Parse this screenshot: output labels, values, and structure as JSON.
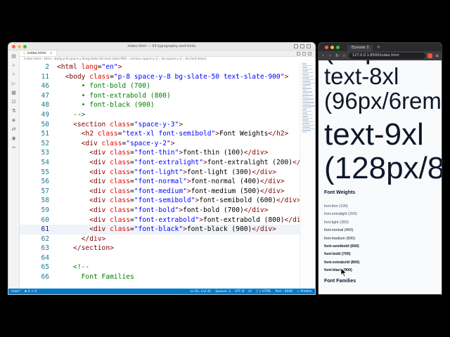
{
  "vscode": {
    "window_title": "index.html — 03-typography-and-fonts",
    "tab": {
      "name": "index.html",
      "close": "×"
    },
    "breadcrumb": "index.html › html › body.p-8.space-y-8.bg-slate-50.text-slate-900 › section.space-y-3 › div.space-y-2 › div.font-black",
    "activity_icons": [
      "files-icon",
      "search-icon",
      "source-control-icon",
      "run-debug-icon",
      "extensions-icon",
      "remote-icon",
      "testing-icon",
      "docker-icon",
      "live-share-icon",
      "github-icon",
      "tailwind-icon"
    ],
    "active_line": 61,
    "lines": [
      {
        "n": "2",
        "c": [
          [
            "t-tag",
            "<html "
          ],
          [
            "t-attr",
            "lang"
          ],
          [
            "t-txt",
            "="
          ],
          [
            "t-str",
            "\"en\""
          ],
          [
            "t-tag",
            ">"
          ]
        ]
      },
      {
        "n": "11",
        "c": [
          [
            "t-txt",
            "  "
          ],
          [
            "t-tag",
            "<body "
          ],
          [
            "t-attr",
            "class"
          ],
          [
            "t-txt",
            "="
          ],
          [
            "t-str",
            "\"p-8 space-y-8 bg-slate-50 text-slate-900\""
          ],
          [
            "t-tag",
            ">"
          ]
        ]
      },
      {
        "n": "46",
        "c": [
          [
            "t-com",
            "      • font-bold (700)"
          ]
        ]
      },
      {
        "n": "47",
        "c": [
          [
            "t-com",
            "      • font-extrabold (800)"
          ]
        ]
      },
      {
        "n": "48",
        "c": [
          [
            "t-com",
            "      • font-black (900)"
          ]
        ]
      },
      {
        "n": "49",
        "c": [
          [
            "t-com",
            "    -->"
          ]
        ]
      },
      {
        "n": "50",
        "c": [
          [
            "t-txt",
            "    "
          ],
          [
            "t-tag",
            "<section "
          ],
          [
            "t-attr",
            "class"
          ],
          [
            "t-txt",
            "="
          ],
          [
            "t-str",
            "\"space-y-3\""
          ],
          [
            "t-tag",
            ">"
          ]
        ]
      },
      {
        "n": "51",
        "c": [
          [
            "t-txt",
            "      "
          ],
          [
            "t-tag",
            "<h2 "
          ],
          [
            "t-attr",
            "class"
          ],
          [
            "t-txt",
            "="
          ],
          [
            "t-str",
            "\"text-xl font-semibold\""
          ],
          [
            "t-tag",
            ">"
          ],
          [
            "t-txt",
            "Font Weights"
          ],
          [
            "t-tag",
            "</h2>"
          ]
        ]
      },
      {
        "n": "52",
        "c": [
          [
            "t-txt",
            "      "
          ],
          [
            "t-tag",
            "<div "
          ],
          [
            "t-attr",
            "class"
          ],
          [
            "t-txt",
            "="
          ],
          [
            "t-str",
            "\"space-y-2\""
          ],
          [
            "t-tag",
            ">"
          ]
        ]
      },
      {
        "n": "53",
        "c": [
          [
            "t-txt",
            "        "
          ],
          [
            "t-tag",
            "<div "
          ],
          [
            "t-attr",
            "class"
          ],
          [
            "t-txt",
            "="
          ],
          [
            "t-str",
            "\"font-thin\""
          ],
          [
            "t-tag",
            ">"
          ],
          [
            "t-txt",
            "font-thin (100)"
          ],
          [
            "t-tag",
            "</div>"
          ]
        ]
      },
      {
        "n": "54",
        "c": [
          [
            "t-txt",
            "        "
          ],
          [
            "t-tag",
            "<div "
          ],
          [
            "t-attr",
            "class"
          ],
          [
            "t-txt",
            "="
          ],
          [
            "t-str",
            "\"font-extralight\""
          ],
          [
            "t-tag",
            ">"
          ],
          [
            "t-txt",
            "font-extralight (200)"
          ],
          [
            "t-tag",
            "</div>"
          ]
        ]
      },
      {
        "n": "55",
        "c": [
          [
            "t-txt",
            "        "
          ],
          [
            "t-tag",
            "<div "
          ],
          [
            "t-attr",
            "class"
          ],
          [
            "t-txt",
            "="
          ],
          [
            "t-str",
            "\"font-light\""
          ],
          [
            "t-tag",
            ">"
          ],
          [
            "t-txt",
            "font-light (300)"
          ],
          [
            "t-tag",
            "</div>"
          ]
        ]
      },
      {
        "n": "56",
        "c": [
          [
            "t-txt",
            "        "
          ],
          [
            "t-tag",
            "<div "
          ],
          [
            "t-attr",
            "class"
          ],
          [
            "t-txt",
            "="
          ],
          [
            "t-str",
            "\"font-normal\""
          ],
          [
            "t-tag",
            ">"
          ],
          [
            "t-txt",
            "font-normal (400)"
          ],
          [
            "t-tag",
            "</div>"
          ]
        ]
      },
      {
        "n": "57",
        "c": [
          [
            "t-txt",
            "        "
          ],
          [
            "t-tag",
            "<div "
          ],
          [
            "t-attr",
            "class"
          ],
          [
            "t-txt",
            "="
          ],
          [
            "t-str",
            "\"font-medium\""
          ],
          [
            "t-tag",
            ">"
          ],
          [
            "t-txt",
            "font-medium (500)"
          ],
          [
            "t-tag",
            "</div>"
          ]
        ]
      },
      {
        "n": "58",
        "c": [
          [
            "t-txt",
            "        "
          ],
          [
            "t-tag",
            "<div "
          ],
          [
            "t-attr",
            "class"
          ],
          [
            "t-txt",
            "="
          ],
          [
            "t-str",
            "\"font-semibold\""
          ],
          [
            "t-tag",
            ">"
          ],
          [
            "t-txt",
            "font-semibold (600)"
          ],
          [
            "t-tag",
            "</div>"
          ]
        ]
      },
      {
        "n": "59",
        "c": [
          [
            "t-txt",
            "        "
          ],
          [
            "t-tag",
            "<div "
          ],
          [
            "t-attr",
            "class"
          ],
          [
            "t-txt",
            "="
          ],
          [
            "t-str",
            "\"font-bold\""
          ],
          [
            "t-tag",
            ">"
          ],
          [
            "t-txt",
            "font-bold (700)"
          ],
          [
            "t-tag",
            "</div>"
          ]
        ]
      },
      {
        "n": "60",
        "c": [
          [
            "t-txt",
            "        "
          ],
          [
            "t-tag",
            "<div "
          ],
          [
            "t-attr",
            "class"
          ],
          [
            "t-txt",
            "="
          ],
          [
            "t-str",
            "\"font-extrabold\""
          ],
          [
            "t-tag",
            ">"
          ],
          [
            "t-txt",
            "font-extrabold (800)"
          ],
          [
            "t-tag",
            "</div>"
          ]
        ]
      },
      {
        "n": "61",
        "c": [
          [
            "t-txt",
            "        "
          ],
          [
            "t-tag",
            "<div "
          ],
          [
            "t-attr",
            "class"
          ],
          [
            "t-txt",
            "="
          ],
          [
            "t-str",
            "\"font-black\""
          ],
          [
            "t-tag",
            ">"
          ],
          [
            "t-txt",
            "font-black (900)"
          ],
          [
            "t-tag",
            "</div>"
          ]
        ]
      },
      {
        "n": "62",
        "c": [
          [
            "t-txt",
            "      "
          ],
          [
            "t-tag",
            "</div>"
          ]
        ]
      },
      {
        "n": "63",
        "c": [
          [
            "t-txt",
            "    "
          ],
          [
            "t-tag",
            "</section>"
          ]
        ]
      },
      {
        "n": "64",
        "c": [
          [
            "t-txt",
            ""
          ]
        ]
      },
      {
        "n": "65",
        "c": [
          [
            "t-com",
            "    <!--"
          ]
        ]
      },
      {
        "n": "66",
        "c": [
          [
            "t-com",
            "      Font Families"
          ]
        ]
      }
    ],
    "status": {
      "left": [
        "main*",
        "⊗ 0 ⚠ 0"
      ],
      "right": [
        "Ln 61, Col 31",
        "Spaces: 2",
        "UTF-8",
        "LF",
        "{ } HTML",
        "Port : 8500",
        "✓ Prettier"
      ]
    }
  },
  "browser": {
    "tab_title": "Episode 3",
    "new_tab": "+",
    "url": "127.0.0.1:8500/index.html",
    "big_text": [
      "text-8xl",
      "(96px/6rem",
      "text-9xl",
      "(128px/8"
    ],
    "section_title": "Font Weights",
    "weights": [
      {
        "label": "font-thin (100)",
        "weight": 100
      },
      {
        "label": "font-extralight (200)",
        "weight": 200
      },
      {
        "label": "font-light (300)",
        "weight": 300
      },
      {
        "label": "font-normal (400)",
        "weight": 400
      },
      {
        "label": "font-medium (500)",
        "weight": 500
      },
      {
        "label": "font-semibold (600)",
        "weight": 600
      },
      {
        "label": "font-bold (700)",
        "weight": 700
      },
      {
        "label": "font-extrabold (800)",
        "weight": 800
      },
      {
        "label": "font-black (900)",
        "weight": 900
      }
    ],
    "next_section_title": "Font Families"
  },
  "colors": {
    "status_bar": "#007acc",
    "tag": "#800000",
    "attr": "#e50000",
    "string": "#0000ff",
    "comment": "#008000",
    "page_bg": "#f8fafc",
    "page_text": "#0f172a"
  }
}
